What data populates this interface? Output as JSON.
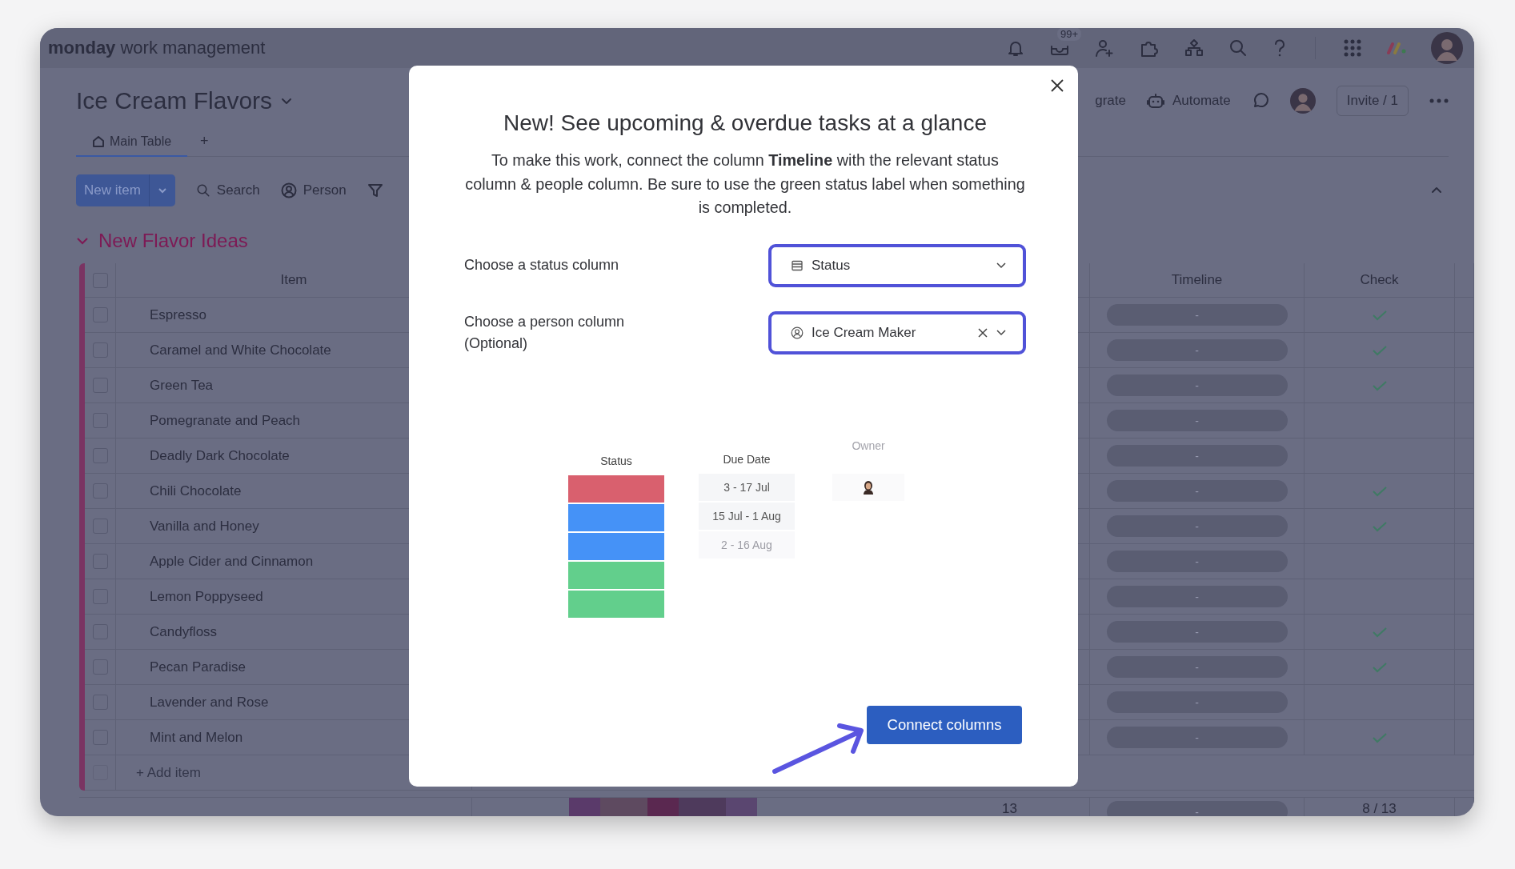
{
  "app": {
    "brand": "monday",
    "product": "work management",
    "notification_badge": "99+"
  },
  "board": {
    "title": "Ice Cream Flavors",
    "tabs": [
      {
        "label": "Main Table",
        "selected": true
      }
    ],
    "add_view": "+",
    "actions": [
      "grate",
      "Automate"
    ],
    "invite": "Invite / 1"
  },
  "toolbar": {
    "new_item": "New item",
    "search": "Search",
    "person": "Person"
  },
  "group": {
    "title": "New Flavor Ideas"
  },
  "table": {
    "columns": [
      "Item",
      "Timeline",
      "Check"
    ],
    "all_selected": false,
    "rows": [
      {
        "item": "Espresso",
        "timeline": "-",
        "check": true,
        "selected": false
      },
      {
        "item": "Caramel and White Chocolate",
        "timeline": "-",
        "check": true,
        "selected": false
      },
      {
        "item": "Green Tea",
        "timeline": "-",
        "check": true,
        "selected": false
      },
      {
        "item": "Pomegranate and Peach",
        "timeline": "-",
        "check": false,
        "selected": false
      },
      {
        "item": "Deadly Dark Chocolate",
        "timeline": "-",
        "check": false,
        "selected": false
      },
      {
        "item": "Chili Chocolate",
        "timeline": "-",
        "check": true,
        "selected": false
      },
      {
        "item": "Vanilla and Honey",
        "timeline": "-",
        "check": true,
        "selected": false
      },
      {
        "item": "Apple Cider and Cinnamon",
        "timeline": "-",
        "check": false,
        "selected": false
      },
      {
        "item": "Lemon Poppyseed",
        "timeline": "-",
        "check": false,
        "selected": false
      },
      {
        "item": "Candyfloss",
        "timeline": "-",
        "check": true,
        "selected": false
      },
      {
        "item": "Pecan Paradise",
        "timeline": "-",
        "check": true,
        "selected": false
      },
      {
        "item": "Lavender and Rose",
        "timeline": "-",
        "check": false,
        "selected": false
      },
      {
        "item": "Mint and Melon",
        "timeline": "-",
        "check": true,
        "selected": false
      }
    ],
    "add_item": "+ Add item",
    "summary": {
      "status_segments": [
        {
          "color": "#5a3a6a"
        },
        {
          "color": "#5e4a60"
        },
        {
          "color": "#5a2850"
        },
        {
          "color": "#4e3a5c"
        },
        {
          "color": "#5a4670"
        }
      ],
      "count": "13",
      "timeline": "-",
      "check": "8 / 13"
    }
  },
  "dialog": {
    "title": "New! See upcoming & overdue tasks at a glance",
    "text": "To make this work, connect the column **Timeline** with the relevant status column & people column. Be sure to use the green status label when something is completed.",
    "fields": [
      {
        "label": "Choose a status column",
        "kind": "status",
        "value": "Status",
        "clearable": false
      },
      {
        "label": "Choose a person column (Optional)",
        "kind": "person",
        "value": "Ice Cream Maker",
        "clearable": true
      }
    ],
    "preview": {
      "headers": [
        {
          "label": "Status",
          "faded": false
        },
        {
          "label": "Due Date",
          "faded": false
        },
        {
          "label": "Owner",
          "faded": true
        }
      ],
      "status_colors": [
        {
          "color": "#d9606e"
        },
        {
          "color": "#4592f7"
        },
        {
          "color": "#4592f7"
        },
        {
          "color": "#62cf8c"
        },
        {
          "color": "#62cf8c"
        }
      ],
      "dates": [
        {
          "text": "3 - 17 Jul",
          "faded": false
        },
        {
          "text": "15 Jul - 1 Aug",
          "faded": false
        },
        {
          "text": "2 - 16 Aug",
          "faded": true
        }
      ]
    },
    "button": "Connect columns"
  }
}
